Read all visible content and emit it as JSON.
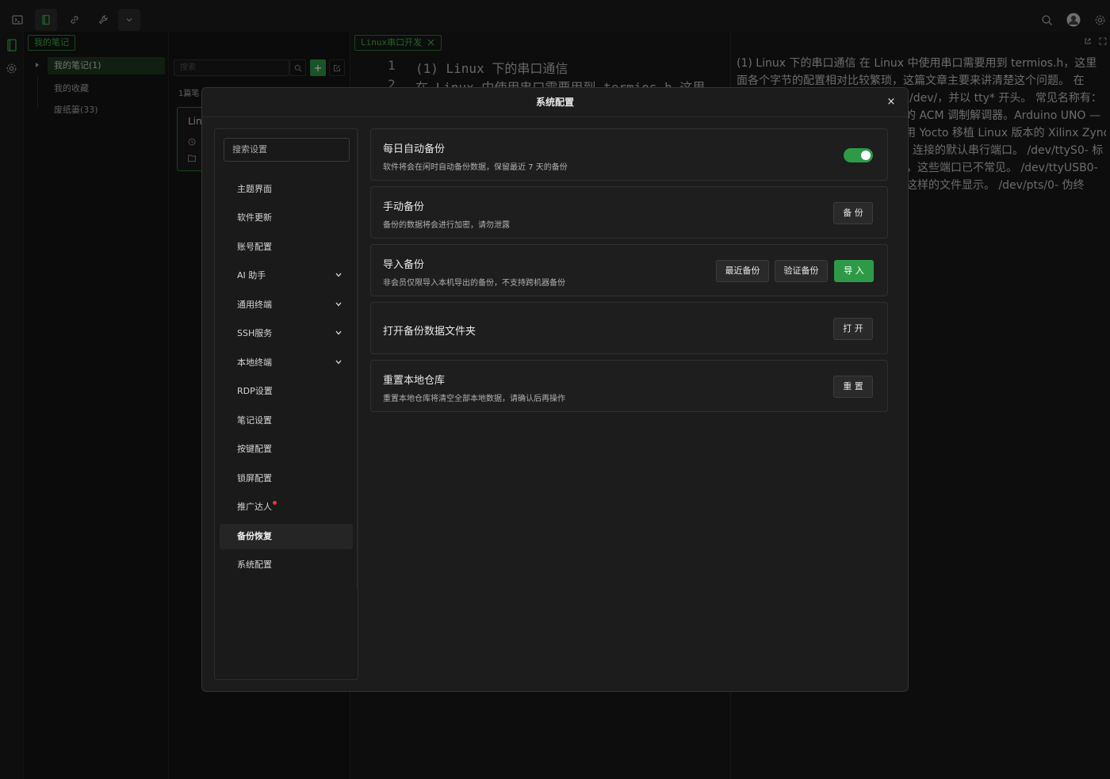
{
  "sidebar": {
    "header_title": "我的笔记",
    "tree": [
      "我的笔记(1)",
      "我的收藏",
      "废纸篓(33)"
    ]
  },
  "note_list": {
    "search_placeholder": "搜索",
    "count": "1篇笔",
    "card_title": "Lin"
  },
  "editor": {
    "tab_title": "Linux串口开发",
    "lines": [
      {
        "num": "1",
        "text": "(1) Linux 下的串口通信"
      },
      {
        "num": "2",
        "text": "在 Linux 中使用串口需要用到 termios.h 这里"
      }
    ]
  },
  "preview": {
    "lines": [
      "(1) Linux 下的串口通信 在 Linux 中使用串口需要用到 termios.h，这里",
      "面各个字节的配置相对比较繁琐，这篇文章主要来讲清楚这个问题。 在",
      "/dev/，并以 tty* 开头。 常见名称有：",
      "的 ACM 调制解调器。Arduino UNO —",
      "用 Yocto 移植 Linux 版本的 Xilinx Zynq",
      "连接的默认串行端口。 /dev/ttyS0- 标",
      "，这些端口已不常见。 /dev/ttyUSB0-",
      "这样的文件显示。 /dev/pts/0- 伪终"
    ]
  },
  "modal": {
    "title": "系统配置",
    "close": "×",
    "search_placeholder": "搜索设置",
    "nav": [
      {
        "label": "主题界面"
      },
      {
        "label": "软件更新"
      },
      {
        "label": "账号配置"
      },
      {
        "label": "AI 助手"
      },
      {
        "label": "通用终端"
      },
      {
        "label": "SSH服务"
      },
      {
        "label": "本地终端"
      },
      {
        "label": "RDP设置"
      },
      {
        "label": "笔记设置"
      },
      {
        "label": "按键配置"
      },
      {
        "label": "锁屏配置"
      },
      {
        "label": "推广达人"
      },
      {
        "label": "备份恢复"
      },
      {
        "label": "系统配置"
      }
    ],
    "cards": {
      "auto_backup": {
        "title": "每日自动备份",
        "desc": "软件将会在闲时自动备份数据，保留最近 7 天的备份",
        "enabled": true
      },
      "manual_backup": {
        "title": "手动备份",
        "desc": "备份的数据将会进行加密，请勿泄露",
        "button": "备 份"
      },
      "import_backup": {
        "title": "导入备份",
        "desc": "非会员仅限导入本机导出的备份，不支持跨机器备份",
        "btn_recent": "最近备份",
        "btn_verify": "验证备份",
        "btn_import": "导 入"
      },
      "open_folder": {
        "title": "打开备份数据文件夹",
        "button": "打 开"
      },
      "reset_repo": {
        "title": "重置本地仓库",
        "desc": "重置本地仓库将清空全部本地数据，请确认后再操作",
        "button": "重 置"
      }
    }
  },
  "colors": {
    "accent": "#2e9a47",
    "alert": "#e53935"
  }
}
